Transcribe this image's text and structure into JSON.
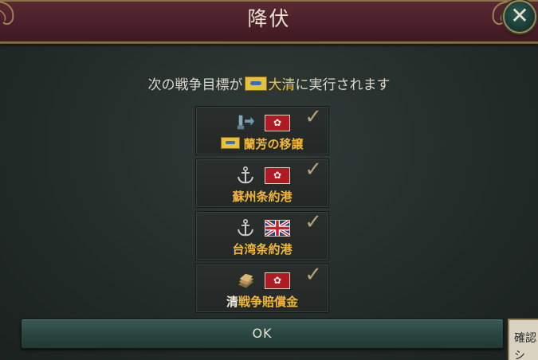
{
  "dialog": {
    "title": "降伏",
    "subtitle_before": "次の戦争目標が",
    "subtitle_country": "大清",
    "subtitle_after": "に実行されます",
    "close_icon": "close-icon"
  },
  "goals": [
    {
      "icon": "transfer-state-icon",
      "flag": "japan",
      "label_a": "蘭芳の移譲",
      "label_b": ""
    },
    {
      "icon": "anchor-icon",
      "flag": "japan",
      "label_a": "蘇州",
      "label_b": "条約港"
    },
    {
      "icon": "anchor-icon",
      "flag": "uk",
      "label_a": "台湾",
      "label_b": "条約港"
    },
    {
      "icon": "reparations-icon",
      "flag": "japan",
      "label_a": "清",
      "label_b": "戦争賠償金"
    }
  ],
  "ok_button": {
    "label": "OK"
  },
  "side_tooltip": {
    "line1": "確認",
    "line2": "シ"
  },
  "colors": {
    "accent": "#f1b73b",
    "header": "#4a1f29",
    "ok_button": "#2b4641"
  }
}
